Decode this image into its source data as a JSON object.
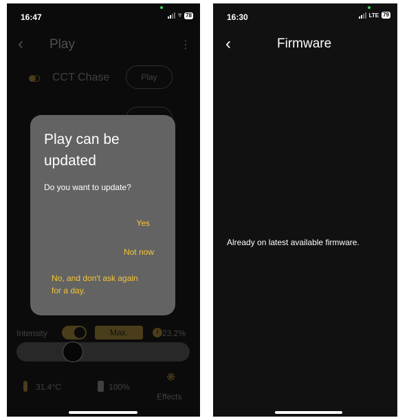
{
  "left_screen": {
    "status": {
      "time": "16:47",
      "battery": "78"
    },
    "header": {
      "back_icon": "chevron-left-icon",
      "title": "Play",
      "menu_icon": "kebab-menu-icon"
    },
    "effect_row": {
      "icon": "cct-chase-icon",
      "label": "CCT Chase",
      "play_label": "Play"
    },
    "dialog": {
      "title": "Play can be updated",
      "message": "Do you want to update?",
      "yes_label": "Yes",
      "not_now_label": "Not now",
      "no_dont_ask_label": "No, and don't ask again for a day."
    },
    "controls": {
      "intensity_label": "Intensity",
      "max_label": "Max.",
      "intensity_value": "23.2%",
      "slider_level_percent": 30
    },
    "footer": {
      "temperature": "31.4°C",
      "battery_level": "100%",
      "effects_label": "Effects"
    },
    "colors": {
      "accent": "#f5c535",
      "dialog_bg": "#636363",
      "background": "#0b0b0b"
    }
  },
  "right_screen": {
    "status": {
      "time": "16:30",
      "network": "LTE",
      "battery": "79"
    },
    "header": {
      "back_icon": "chevron-left-icon",
      "title": "Firmware"
    },
    "message": "Already on latest available firmware."
  }
}
